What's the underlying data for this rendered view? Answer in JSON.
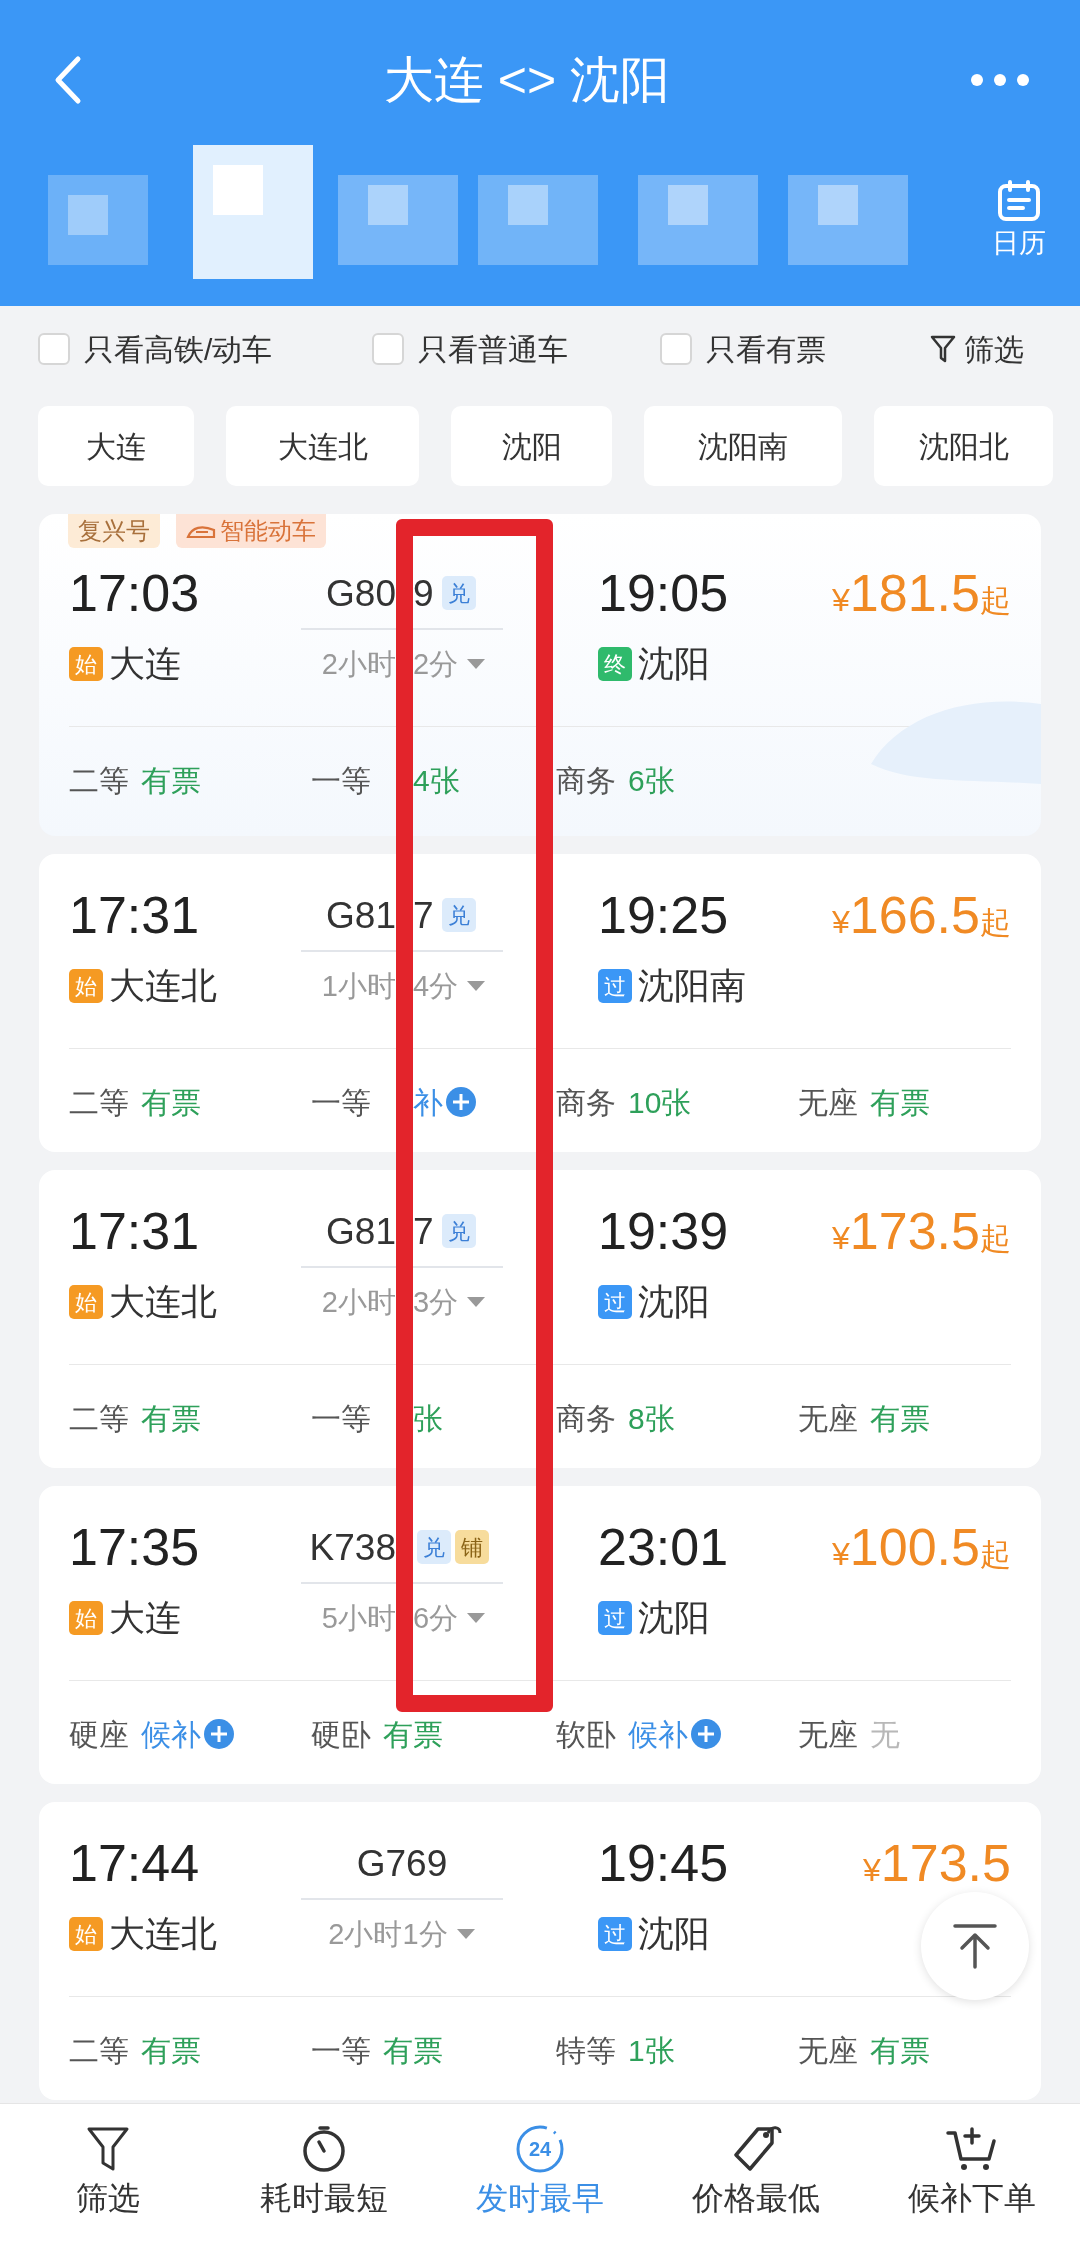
{
  "header": {
    "title": "大连 <> 沈阳",
    "calendar_label": "日历"
  },
  "filters": [
    {
      "label": "只看高铁/动车",
      "checked": false
    },
    {
      "label": "只看普通车",
      "checked": false
    },
    {
      "label": "只看有票",
      "checked": false
    }
  ],
  "filter_button": "筛选",
  "stations": [
    {
      "label": "大连",
      "selected": false
    },
    {
      "label": "大连北",
      "selected": false
    },
    {
      "label": "沈阳",
      "selected": false
    },
    {
      "label": "沈阳南",
      "selected": false
    },
    {
      "label": "沈阳北",
      "selected": false
    }
  ],
  "trains": [
    {
      "labels": [
        {
          "text": "复兴号",
          "kind": "series"
        },
        {
          "text": "智能动车",
          "kind": "smart"
        }
      ],
      "depart": "17:03",
      "under_mark": true,
      "number_parts": [
        "G80",
        "9"
      ],
      "tags": [
        {
          "text": "兑",
          "kind": "exchange"
        }
      ],
      "duration_parts": [
        "2小时",
        "2分"
      ],
      "from": {
        "badge": "始",
        "kind": "start",
        "name": "大连"
      },
      "arrive": "19:05",
      "to": {
        "badge": "终",
        "kind": "end",
        "name": "沈阳"
      },
      "price": {
        "currency": "¥",
        "amount": "181.5",
        "suffix": "起"
      },
      "seats": [
        {
          "label": "二等",
          "value": "有票",
          "kind": "available",
          "under_mark": false
        },
        {
          "label": "一等",
          "value": "4张",
          "kind": "available",
          "under_mark": true
        },
        {
          "label": "商务",
          "value": "6张",
          "kind": "available",
          "under_mark": false
        }
      ]
    },
    {
      "depart": "17:31",
      "under_mark": true,
      "number_parts": [
        "G81",
        "7"
      ],
      "tags": [
        {
          "text": "兑",
          "kind": "exchange"
        }
      ],
      "duration_parts": [
        "1小时",
        "4分"
      ],
      "from": {
        "badge": "始",
        "kind": "start",
        "name": "大连北"
      },
      "arrive": "19:25",
      "to": {
        "badge": "过",
        "kind": "pass",
        "name": "沈阳南"
      },
      "price": {
        "currency": "¥",
        "amount": "166.5",
        "suffix": "起"
      },
      "seats": [
        {
          "label": "二等",
          "value": "有票",
          "kind": "available",
          "under_mark": false
        },
        {
          "label": "一等",
          "value": "补",
          "kind": "waitlist",
          "under_mark": true
        },
        {
          "label": "商务",
          "value": "10张",
          "kind": "available",
          "under_mark": false
        },
        {
          "label": "无座",
          "value": "有票",
          "kind": "available",
          "under_mark": false
        }
      ]
    },
    {
      "depart": "17:31",
      "under_mark": true,
      "number_parts": [
        "G81",
        "7"
      ],
      "tags": [
        {
          "text": "兑",
          "kind": "exchange"
        }
      ],
      "duration_parts": [
        "2小时",
        "3分"
      ],
      "from": {
        "badge": "始",
        "kind": "start",
        "name": "大连北"
      },
      "arrive": "19:39",
      "to": {
        "badge": "过",
        "kind": "pass",
        "name": "沈阳"
      },
      "price": {
        "currency": "¥",
        "amount": "173.5",
        "suffix": "起"
      },
      "seats": [
        {
          "label": "二等",
          "value": "有票",
          "kind": "available",
          "under_mark": false
        },
        {
          "label": "一等",
          "value": "张",
          "kind": "available",
          "under_mark": true
        },
        {
          "label": "商务",
          "value": "8张",
          "kind": "available",
          "under_mark": false
        },
        {
          "label": "无座",
          "value": "有票",
          "kind": "available",
          "under_mark": false
        }
      ]
    },
    {
      "depart": "17:35",
      "under_mark": true,
      "number_parts": [
        "K738"
      ],
      "tags": [
        {
          "text": "兑",
          "kind": "exchange"
        },
        {
          "text": "铺",
          "kind": "berth"
        }
      ],
      "duration_parts": [
        "5小时",
        "6分"
      ],
      "from": {
        "badge": "始",
        "kind": "start",
        "name": "大连"
      },
      "arrive": "23:01",
      "to": {
        "badge": "过",
        "kind": "pass",
        "name": "沈阳"
      },
      "price": {
        "currency": "¥",
        "amount": "100.5",
        "suffix": "起"
      },
      "seats": [
        {
          "label": "硬座",
          "value": "候补",
          "kind": "waitlist",
          "under_mark": false
        },
        {
          "label": "硬卧",
          "value": "有票",
          "kind": "available",
          "under_mark": false
        },
        {
          "label": "软卧",
          "value": "候补",
          "kind": "waitlist",
          "under_mark": false
        },
        {
          "label": "无座",
          "value": "无",
          "kind": "none",
          "under_mark": false
        }
      ]
    },
    {
      "depart": "17:44",
      "under_mark": false,
      "number_parts": [
        "G769"
      ],
      "duration_parts": [
        "2小时1分"
      ],
      "from": {
        "badge": "始",
        "kind": "start",
        "name": "大连北"
      },
      "arrive": "19:45",
      "to": {
        "badge": "过",
        "kind": "pass",
        "name": "沈阳"
      },
      "price": {
        "currency": "¥",
        "amount": "173.5"
      },
      "seats": [
        {
          "label": "二等",
          "value": "有票",
          "kind": "available",
          "under_mark": false
        },
        {
          "label": "一等",
          "value": "有票",
          "kind": "available",
          "under_mark": false
        },
        {
          "label": "特等",
          "value": "1张",
          "kind": "available",
          "under_mark": false
        },
        {
          "label": "无座",
          "value": "有票",
          "kind": "available",
          "under_mark": false
        }
      ]
    }
  ],
  "bottom_nav": [
    {
      "label": "筛选",
      "selected": false
    },
    {
      "label": "耗时最短",
      "selected": false
    },
    {
      "label": "发时最早",
      "badge": "24",
      "selected": true
    },
    {
      "label": "价格最低",
      "selected": false
    },
    {
      "label": "候补下单",
      "selected": false
    }
  ]
}
